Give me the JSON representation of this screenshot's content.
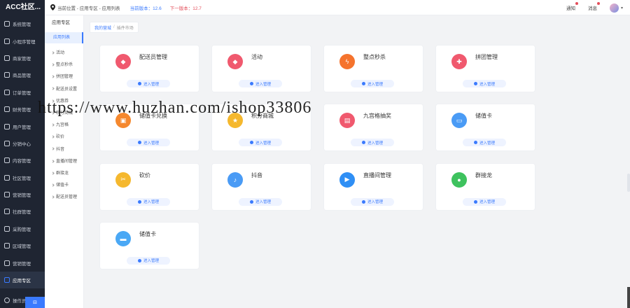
{
  "app": {
    "brand": "ACC社区..."
  },
  "header": {
    "location_label": "当前位置 - 应用专区 - 应用列表",
    "current_version": "当前版本：12.6",
    "next_version": "下一版本：12.7",
    "notice_label": "通知",
    "msg_label": "消息"
  },
  "sidebar": {
    "items": [
      {
        "label": "系统管理"
      },
      {
        "label": "小程序管理"
      },
      {
        "label": "商家管理"
      },
      {
        "label": "商品管理"
      },
      {
        "label": "订单管理"
      },
      {
        "label": "财务管理"
      },
      {
        "label": "用户管理"
      },
      {
        "label": "分销中心"
      },
      {
        "label": "内容管理"
      },
      {
        "label": "社区管理"
      },
      {
        "label": "营销管理"
      },
      {
        "label": "社群管理"
      },
      {
        "label": "采购管理"
      },
      {
        "label": "区域管理"
      },
      {
        "label": "营销管理"
      },
      {
        "label": "应用专区"
      }
    ],
    "bottom_label": "操作员管理",
    "collapse_label": "⊟"
  },
  "submenu": {
    "title": "应用专区",
    "active": "应用列表",
    "items": [
      {
        "label": "活动"
      },
      {
        "label": "整点秒杀"
      },
      {
        "label": "拼团管理"
      },
      {
        "label": "配送员设置"
      },
      {
        "label": "优惠券"
      },
      {
        "label": "积分商城"
      },
      {
        "label": "九宫格"
      },
      {
        "label": "砍价"
      },
      {
        "label": "抖音"
      },
      {
        "label": "直播间管理"
      },
      {
        "label": "群接龙"
      },
      {
        "label": "储值卡"
      },
      {
        "label": "配送员管理"
      }
    ]
  },
  "breadcrumb": {
    "home": "我的营城",
    "current": "插件市场"
  },
  "cards": [
    {
      "name": "配送员管理",
      "color": "#f0596e",
      "icon": "tag-icon",
      "enter": "进入管理"
    },
    {
      "name": "活动",
      "color": "#f0596e",
      "icon": "tag-icon",
      "enter": "进入管理"
    },
    {
      "name": "整点秒杀",
      "color": "#f5732d",
      "icon": "flash-icon",
      "enter": "进入管理"
    },
    {
      "name": "拼团管理",
      "color": "#f0596e",
      "icon": "puzzle-icon",
      "enter": "进入管理"
    },
    {
      "name": "储值卡兑换",
      "color": "#f5882e",
      "icon": "gift-icon",
      "enter": "进入管理"
    },
    {
      "name": "积分商城",
      "color": "#f5b82e",
      "icon": "star-icon",
      "enter": "进入管理"
    },
    {
      "name": "九宫格抽奖",
      "color": "#f0596e",
      "icon": "box-icon",
      "enter": "进入管理"
    },
    {
      "name": "储值卡",
      "color": "#4a9bf5",
      "icon": "card-icon",
      "enter": "进入管理"
    },
    {
      "name": "砍价",
      "color": "#f5b82e",
      "icon": "cut-icon",
      "enter": "进入管理"
    },
    {
      "name": "抖音",
      "color": "#4a9bf5",
      "icon": "music-icon",
      "enter": "进入管理"
    },
    {
      "name": "直播间管理",
      "color": "#2f8ff5",
      "icon": "play-icon",
      "enter": "进入管理"
    },
    {
      "name": "群接龙",
      "color": "#3ec25e",
      "icon": "chat-icon",
      "enter": "进入管理"
    },
    {
      "name": "储值卡",
      "color": "#4aa8f5",
      "icon": "wallet-icon",
      "enter": "进入管理"
    }
  ],
  "watermark": "https://www.huzhan.com/ishop33806"
}
